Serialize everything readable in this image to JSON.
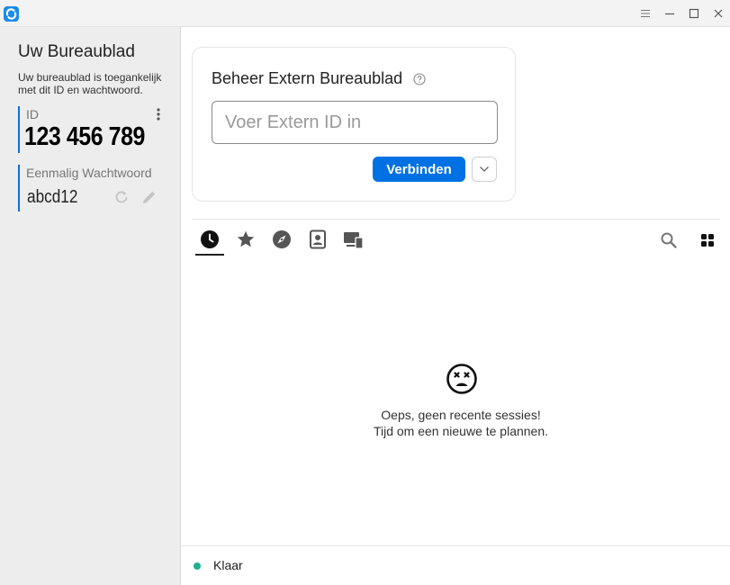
{
  "window": {
    "controls": [
      "menu-icon",
      "minimize-icon",
      "maximize-icon",
      "close-icon"
    ]
  },
  "sidebar": {
    "title": "Uw Bureaublad",
    "description": "Uw bureaublad is toegankelijk met dit ID en wachtwoord.",
    "id_label": "ID",
    "id_value": "123 456 789",
    "password_label": "Eenmalig Wachtwoord",
    "password_value": "abcd12"
  },
  "connect": {
    "title": "Beheer Extern Bureaublad",
    "input_placeholder": "Voer Extern ID in",
    "input_value": "",
    "connect_label": "Verbinden"
  },
  "tabs": [
    {
      "icon": "clock-icon",
      "active": true
    },
    {
      "icon": "star-icon",
      "active": false
    },
    {
      "icon": "compass-icon",
      "active": false
    },
    {
      "icon": "address-book-icon",
      "active": false
    },
    {
      "icon": "devices-icon",
      "active": false
    }
  ],
  "empty_state": {
    "icon": "sad-face-icon",
    "line1": "Oeps, geen recente sessies!",
    "line2": "Tijd om een nieuwe te plannen."
  },
  "status": {
    "text": "Klaar",
    "color": "#1fb093"
  },
  "colors": {
    "accent": "#0071e3",
    "sidebar_bg": "#ededed",
    "status_ok": "#1fb093"
  }
}
